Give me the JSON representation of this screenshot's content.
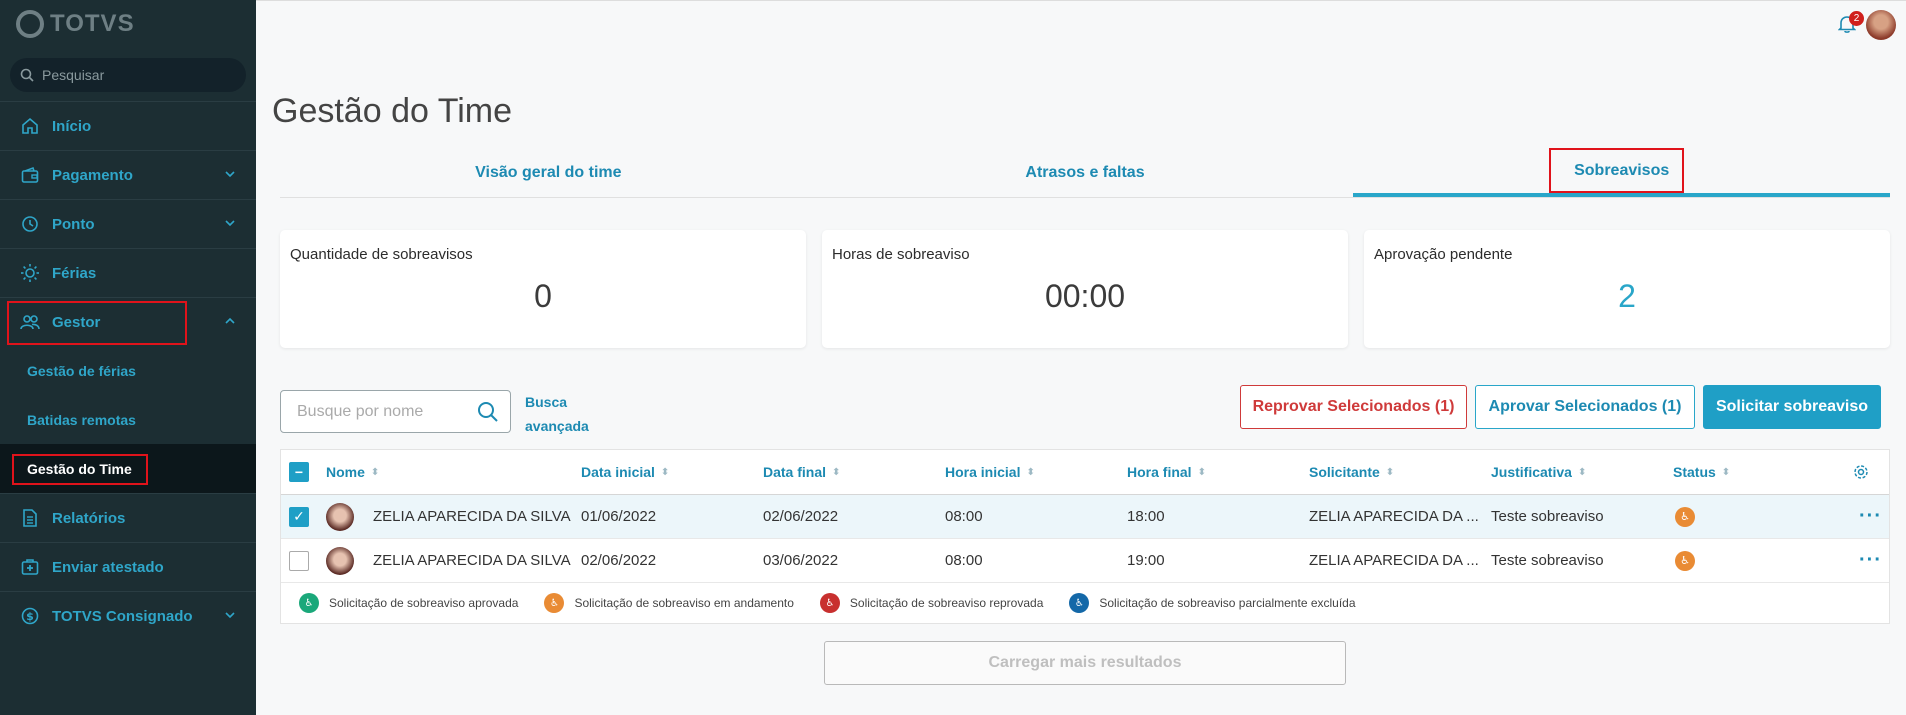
{
  "app": {
    "logo_text": "TOTVS"
  },
  "sidebar": {
    "search_placeholder": "Pesquisar",
    "items": [
      {
        "label": "Início",
        "icon": "home-icon"
      },
      {
        "label": "Pagamento",
        "icon": "wallet-icon",
        "expandable": true
      },
      {
        "label": "Ponto",
        "icon": "clock-icon",
        "expandable": true
      },
      {
        "label": "Férias",
        "icon": "sun-icon"
      },
      {
        "label": "Gestor",
        "icon": "team-icon",
        "expanded": true
      },
      {
        "label": "Relatórios",
        "icon": "document-icon"
      },
      {
        "label": "Enviar atestado",
        "icon": "medical-plus-icon"
      },
      {
        "label": "TOTVS Consignado",
        "icon": "dollar-icon",
        "expandable": true
      }
    ],
    "gestor_subitems": [
      {
        "label": "Gestão de férias"
      },
      {
        "label": "Batidas remotas"
      },
      {
        "label": "Gestão do Time",
        "active": true
      }
    ]
  },
  "header": {
    "notifications_count": "2"
  },
  "page": {
    "title": "Gestão do Time",
    "tabs": [
      {
        "label": "Visão geral do time"
      },
      {
        "label": "Atrasos e faltas"
      },
      {
        "label": "Sobreavisos",
        "active": true
      }
    ]
  },
  "cards": [
    {
      "title": "Quantidade de sobreavisos",
      "value": "0"
    },
    {
      "title": "Horas de sobreaviso",
      "value": "00:00"
    },
    {
      "title": "Aprovação pendente",
      "value": "2"
    }
  ],
  "filters": {
    "name_placeholder": "Busque por nome",
    "advanced_search_label": "Busca avançada"
  },
  "actions": {
    "reject_label": "Reprovar Selecionados (1)",
    "approve_label": "Aprovar Selecionados (1)",
    "request_label": "Solicitar sobreaviso"
  },
  "table": {
    "columns": [
      "Nome",
      "Data inicial",
      "Data final",
      "Hora inicial",
      "Hora final",
      "Solicitante",
      "Justificativa",
      "Status"
    ],
    "rows": [
      {
        "selected": true,
        "nome": "ZELIA APARECIDA DA SILVA",
        "data_inicial": "01/06/2022",
        "data_final": "02/06/2022",
        "hora_inicial": "08:00",
        "hora_final": "18:00",
        "solicitante": "ZELIA APARECIDA DA ...",
        "justificativa": "Teste sobreaviso",
        "status": "em andamento"
      },
      {
        "selected": false,
        "nome": "ZELIA APARECIDA DA SILVA",
        "data_inicial": "02/06/2022",
        "data_final": "03/06/2022",
        "hora_inicial": "08:00",
        "hora_final": "19:00",
        "solicitante": "ZELIA APARECIDA DA ...",
        "justificativa": "Teste sobreaviso",
        "status": "em andamento"
      }
    ]
  },
  "legend": [
    {
      "label": "Solicitação de sobreaviso aprovada",
      "color": "#1aa87a"
    },
    {
      "label": "Solicitação de sobreaviso em andamento",
      "color": "#e98b34"
    },
    {
      "label": "Solicitação de sobreaviso reprovada",
      "color": "#c8302f"
    },
    {
      "label": "Solicitação de sobreaviso parcialmente excluída",
      "color": "#1468a8"
    }
  ],
  "load_more_label": "Carregar mais resultados",
  "colors": {
    "sidebar_bg": "#1c2e33",
    "accent": "#1f9fc6",
    "danger": "#cf3a3a",
    "highlight_box": "#e0131b"
  }
}
